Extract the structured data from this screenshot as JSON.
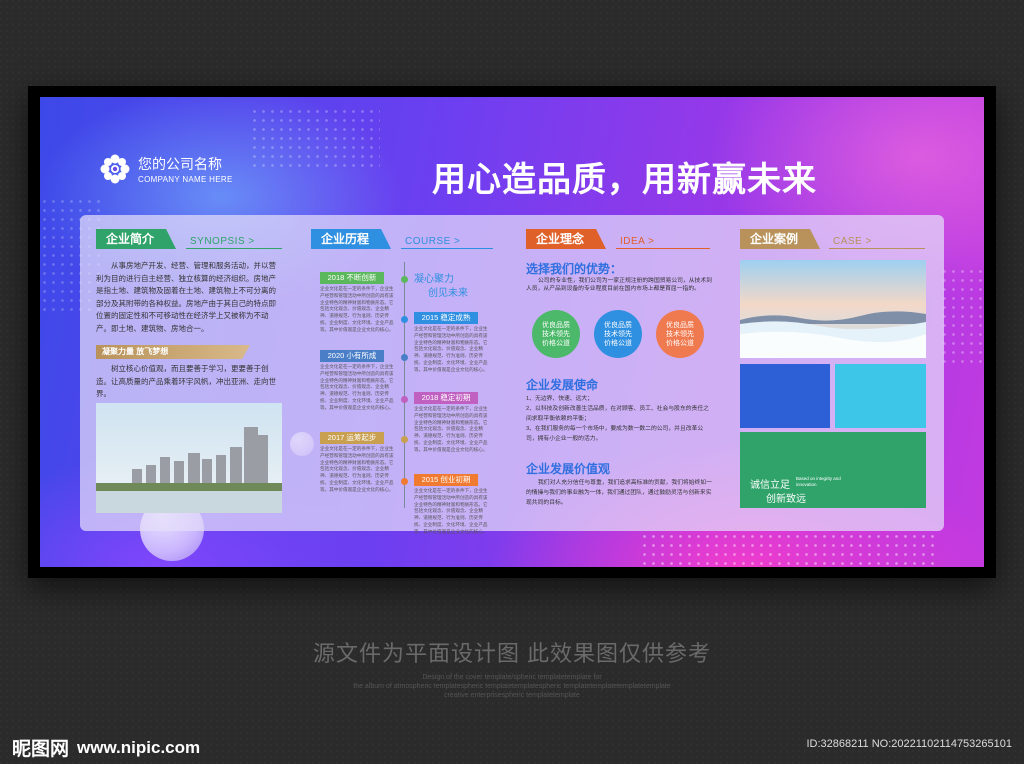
{
  "logo": {
    "name": "您的公司名称",
    "english": "COMPANY NAME HERE",
    "icon": "flower-logo-icon"
  },
  "slogan": "用心造品质，用新赢未来",
  "synopsis": {
    "tag": "企业简介",
    "tag_en": "SYNOPSIS >",
    "paragraph": "从事房地产开发、经营、管理和服务活动，并以营利为目的进行自主经营、独立核算的经济组织。房地产是指土地、建筑物及固着在土地、建筑物上不可分离的部分及其附带的各种权益。房地产由于其自己的特点即位置的固定性和不可移动性在经济学上又被称为不动产。即土地、建筑物、房地合一。",
    "sub_title": "凝聚力量 放飞梦想",
    "sub_paragraph": "树立核心价值观，而且要善于学习，更要善于创造。让高质量的产品乘着环宇风帆，冲出亚洲、走向世界。"
  },
  "course": {
    "tag": "企业历程",
    "tag_en": "COURSE >",
    "motto_1": "凝心聚力",
    "motto_2": "创见未来",
    "left": [
      {
        "year": "2018 不断创新",
        "color": "#5cb85c"
      },
      {
        "year": "2020 小有所成",
        "color": "#4a7fc8"
      },
      {
        "year": "2017 运筹起步",
        "color": "#c8a050"
      }
    ],
    "right": [
      {
        "year": "2015 稳定成熟",
        "color": "#2f8fe0"
      },
      {
        "year": "2018 稳定初期",
        "color": "#c060c0"
      },
      {
        "year": "2015 创业初期",
        "color": "#f07a30"
      }
    ],
    "item_text": "企业文化是在一定的条件下，企业生产经营和管理活动中所创造的具有该企业特色的精神财富和物质形态。它包括文化观念、价值观念、企业精神、道德规范、行为准则、历史传统、企业制度、文化环境、企业产品等。其中价值观是企业文化的核心。"
  },
  "idea": {
    "tag": "企业理念",
    "tag_en": "IDEA >",
    "heading_1": "选择我们的优势：",
    "text_1": "公司的专业性，我们公司为一家正规注册的跨国贸易公司，从技术到人员，从产品到设备的专业程度目前在国内市场上都是首屈一指的。",
    "circles": [
      {
        "lines": [
          "优良品质",
          "技术领先",
          "价格公道"
        ],
        "color": "#4cb86a"
      },
      {
        "lines": [
          "优良品质",
          "技术领先",
          "价格公道"
        ],
        "color": "#2f8fe0"
      },
      {
        "lines": [
          "优良品质",
          "技术领先",
          "价格公道"
        ],
        "color": "#f07a50"
      }
    ],
    "heading_2": "企业发展使命",
    "mission": [
      "1、无边界、快速、远大；",
      "2、以科技及创新改善生活品质，在对顾客、员工、社会与股东的责任之间求取平衡依赖的平衡；",
      "3、在我们服务的每一个市场中，要成为数一数二的公司，并且改革公司，拥有小企业一般的活力。"
    ],
    "heading_3": "企业发展价值观",
    "values_text": "我们对人充分信任与尊重，我们追求高标准的贡献，我们将始终如一的情操与我们的事业融为一体，我们通过团队，通过鼓励灵活与创新来实现共同的目标。"
  },
  "case": {
    "tag": "企业案例",
    "tag_en": "CASE >",
    "box_title_1": "诚信立足",
    "box_title_2": "创新致远",
    "box_en": "Based on integrity and innovation",
    "colors": {
      "blue": "#2d5fd6",
      "cyan": "#3ec6e8",
      "green": "#2fa36a"
    }
  },
  "footer": {
    "notice": "源文件为平面设计图 此效果图仅供参考",
    "en_line_1": "Design of the cover template/spheric templatetemplate for",
    "en_line_2": "the album of atmospheric templatespheric templatetemplatespheric templatetemplatetemplatetemplate",
    "en_line_3": "creative enterprisespheric templatetemplate",
    "site_cn": "昵图网",
    "site_url": "www.nipic.com",
    "id_text": "ID:32868211 NO:20221102114753265101"
  }
}
